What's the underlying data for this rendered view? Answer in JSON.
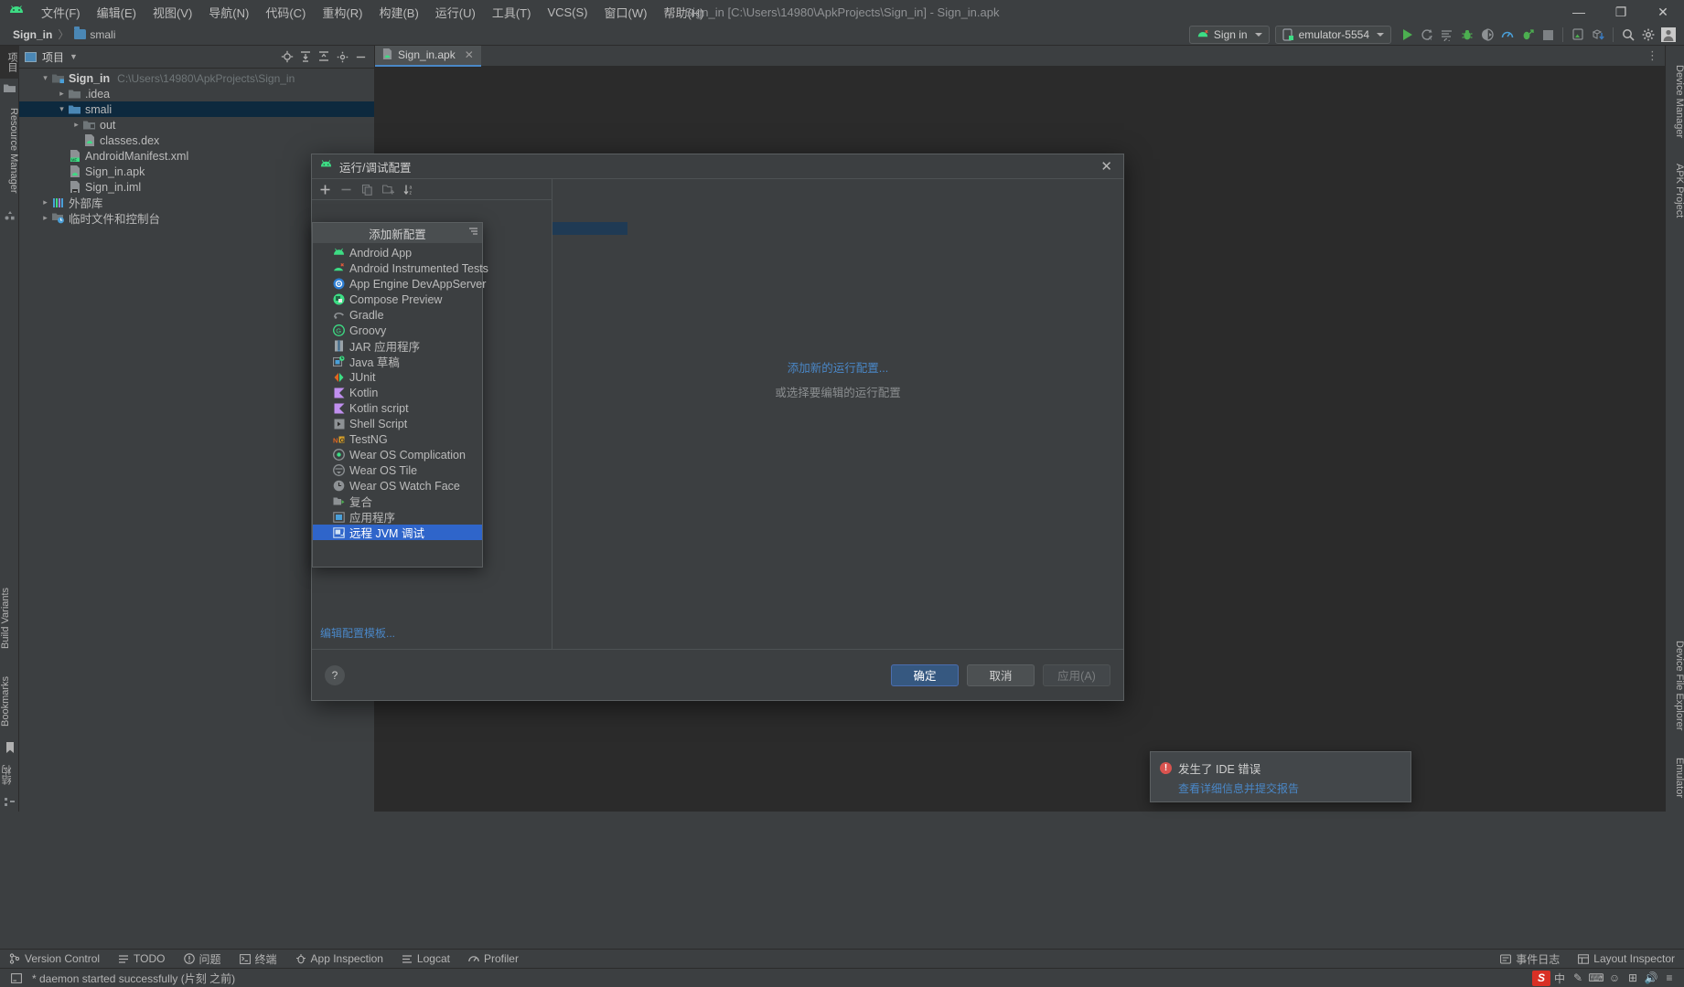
{
  "window": {
    "title": "Sign_in [C:\\Users\\14980\\ApkProjects\\Sign_in] - Sign_in.apk",
    "minimize": "—",
    "maximize": "❐",
    "close": "✕"
  },
  "menubar": {
    "items": [
      {
        "label": "文件(F)"
      },
      {
        "label": "编辑(E)"
      },
      {
        "label": "视图(V)"
      },
      {
        "label": "导航(N)"
      },
      {
        "label": "代码(C)"
      },
      {
        "label": "重构(R)"
      },
      {
        "label": "构建(B)"
      },
      {
        "label": "运行(U)"
      },
      {
        "label": "工具(T)"
      },
      {
        "label": "VCS(S)"
      },
      {
        "label": "窗口(W)"
      },
      {
        "label": "帮助(H)"
      }
    ]
  },
  "navbar": {
    "crumbs": [
      {
        "label": "Sign_in"
      },
      {
        "label": "smali"
      }
    ],
    "separator": "〉"
  },
  "toolbar": {
    "run_config": "Sign in",
    "device": "emulator-5554",
    "icons": [
      "run-icon",
      "rerun-icon",
      "run-with-coverage-icon",
      "debug-icon",
      "attach-debugger-icon",
      "profiler-icon",
      "apply-changes-icon",
      "stop-icon",
      "device-manager-icon",
      "sdk-download-icon",
      "search-icon",
      "settings-icon",
      "avatar-icon"
    ]
  },
  "left_strip": {
    "top_tabs": [
      {
        "label": "项目"
      }
    ],
    "tabs": [
      {
        "label": "Resource Manager"
      }
    ],
    "bottom_tabs": [
      {
        "label": "结构"
      },
      {
        "label": "Bookmarks"
      },
      {
        "label": "Build Variants"
      }
    ]
  },
  "right_strip": {
    "tabs": [
      {
        "label": "Device Manager"
      },
      {
        "label": "APK Project"
      },
      {
        "label": "Emulator"
      },
      {
        "label": "Device File Explorer"
      }
    ]
  },
  "project_panel": {
    "title": "项目",
    "tree": [
      {
        "indent": 0,
        "arrow": "▾",
        "icon": "module-icon",
        "name": "Sign_in",
        "bold": true,
        "path": "C:\\Users\\14980\\ApkProjects\\Sign_in",
        "selected": false
      },
      {
        "indent": 1,
        "arrow": "▸",
        "icon": "folder-icon",
        "name": ".idea",
        "bold": false,
        "path": "",
        "selected": false
      },
      {
        "indent": 1,
        "arrow": "▾",
        "icon": "folder-icon",
        "name": "smali",
        "bold": false,
        "path": "",
        "selected": true
      },
      {
        "indent": 2,
        "arrow": "▸",
        "icon": "folder-excluded-icon",
        "name": "out",
        "bold": false,
        "path": "",
        "selected": false
      },
      {
        "indent": 2,
        "arrow": "",
        "icon": "dex-file-icon",
        "name": "classes.dex",
        "bold": false,
        "path": "",
        "selected": false
      },
      {
        "indent": 1,
        "arrow": "",
        "icon": "manifest-file-icon",
        "name": "AndroidManifest.xml",
        "bold": false,
        "path": "",
        "selected": false
      },
      {
        "indent": 1,
        "arrow": "",
        "icon": "apk-file-icon",
        "name": "Sign_in.apk",
        "bold": false,
        "path": "",
        "selected": false
      },
      {
        "indent": 1,
        "arrow": "",
        "icon": "iml-file-icon",
        "name": "Sign_in.iml",
        "bold": false,
        "path": "",
        "selected": false
      },
      {
        "indent": 0,
        "arrow": "▸",
        "icon": "library-icon",
        "name": "外部库",
        "bold": false,
        "path": "",
        "selected": false
      },
      {
        "indent": 0,
        "arrow": "▸",
        "icon": "scratches-icon",
        "name": "临时文件和控制台",
        "bold": false,
        "path": "",
        "selected": false
      }
    ]
  },
  "editor": {
    "tabs": [
      {
        "label": "Sign_in.apk",
        "icon": "apk-file-icon",
        "close": "✕",
        "active": true
      }
    ],
    "more": "⋮"
  },
  "dialog": {
    "title": "运行/调试配置",
    "close": "✕",
    "toolbar_icons": [
      "add-icon",
      "remove-icon",
      "copy-icon",
      "new-folder-icon",
      "sort-icon"
    ],
    "popup": {
      "header": "添加新配置",
      "pin_icon": "filter-icon",
      "items": [
        {
          "label": "Android App",
          "icon": "android-icon",
          "selected": false
        },
        {
          "label": "Android Instrumented Tests",
          "icon": "android-test-icon",
          "selected": false
        },
        {
          "label": "App Engine DevAppServer",
          "icon": "appengine-icon",
          "selected": false
        },
        {
          "label": "Compose Preview",
          "icon": "compose-icon",
          "selected": false
        },
        {
          "label": "Gradle",
          "icon": "gradle-icon",
          "selected": false
        },
        {
          "label": "Groovy",
          "icon": "groovy-icon",
          "selected": false
        },
        {
          "label": "JAR 应用程序",
          "icon": "jar-icon",
          "selected": false
        },
        {
          "label": "Java 草稿",
          "icon": "java-scratch-icon",
          "selected": false
        },
        {
          "label": "JUnit",
          "icon": "junit-icon",
          "selected": false
        },
        {
          "label": "Kotlin",
          "icon": "kotlin-icon",
          "selected": false
        },
        {
          "label": "Kotlin script",
          "icon": "kotlin-icon",
          "selected": false
        },
        {
          "label": "Shell Script",
          "icon": "shell-icon",
          "selected": false
        },
        {
          "label": "TestNG",
          "icon": "testng-icon",
          "selected": false
        },
        {
          "label": "Wear OS Complication",
          "icon": "wear-complication-icon",
          "selected": false
        },
        {
          "label": "Wear OS Tile",
          "icon": "wear-tile-icon",
          "selected": false
        },
        {
          "label": "Wear OS Watch Face",
          "icon": "wear-watchface-icon",
          "selected": false
        },
        {
          "label": "复合",
          "icon": "compound-icon",
          "selected": false
        },
        {
          "label": "应用程序",
          "icon": "application-icon",
          "selected": false
        },
        {
          "label": "远程 JVM 调试",
          "icon": "remote-jvm-icon",
          "selected": true
        }
      ]
    },
    "edit_templates_link": "编辑配置模板...",
    "center": {
      "primary": "添加新的运行配置...",
      "secondary": "或选择要编辑的运行配置"
    },
    "help": "?",
    "buttons": {
      "ok": "确定",
      "cancel": "取消",
      "apply": "应用(A)"
    }
  },
  "notification": {
    "title": "发生了 IDE 错误",
    "link": "查看详细信息并提交报告",
    "icon": "error-icon"
  },
  "bottom_bar": {
    "items": [
      {
        "label": "Version Control",
        "icon": "vcs-icon"
      },
      {
        "label": "TODO",
        "icon": "todo-icon"
      },
      {
        "label": "问题",
        "icon": "problems-icon"
      },
      {
        "label": "终端",
        "icon": "terminal-icon"
      },
      {
        "label": "App Inspection",
        "icon": "app-inspection-icon"
      },
      {
        "label": "Logcat",
        "icon": "logcat-icon"
      },
      {
        "label": "Profiler",
        "icon": "profiler-icon"
      }
    ],
    "right_items": [
      {
        "label": "事件日志",
        "icon": "event-log-icon"
      },
      {
        "label": "Layout Inspector",
        "icon": "layout-inspector-icon"
      }
    ]
  },
  "status_bar": {
    "message": "* daemon started successfully (片刻 之前)",
    "icon": "console-icon",
    "ime": {
      "logo": "S",
      "items": [
        "中",
        "✎",
        "⌨",
        "☺",
        "⊞",
        "🔊",
        "≡"
      ]
    }
  }
}
